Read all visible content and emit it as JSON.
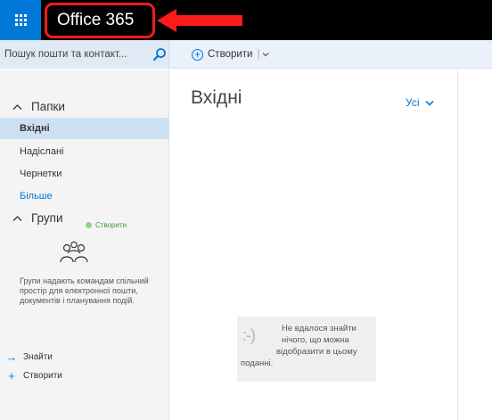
{
  "topbar": {
    "app_name": "Office 365"
  },
  "search": {
    "placeholder": "Пошук пошти та контакт..."
  },
  "toolbar": {
    "create_label": "Створити",
    "separator": "|"
  },
  "sidebar": {
    "folders_header": "Папки",
    "folders": [
      {
        "label": "Вхідні",
        "selected": true
      },
      {
        "label": "Надіслані",
        "selected": false
      },
      {
        "label": "Чернетки",
        "selected": false
      }
    ],
    "more_label": "Більше",
    "groups_header": "Групи",
    "groups_create_label": "Створити",
    "groups_description": "Групи надають командам спільний простір для електронної пошти, документів і планування подій.",
    "actions": [
      {
        "icon": "arrow-right-icon",
        "label": "Знайти"
      },
      {
        "icon": "plus-icon",
        "label": "Створити"
      }
    ]
  },
  "main": {
    "title": "Вхідні",
    "filter_label": "Усі",
    "empty_message": {
      "face": ":-)",
      "line1": "Не вдалося знайти",
      "line2": "нічого, що можна",
      "line3": "відобразити в цьому",
      "line4": "поданні."
    }
  },
  "colors": {
    "accent": "#0078d7",
    "highlight_border": "#ff1a1a",
    "selected_folder": "#cde0f3",
    "create_green": "#3a9c3a"
  }
}
